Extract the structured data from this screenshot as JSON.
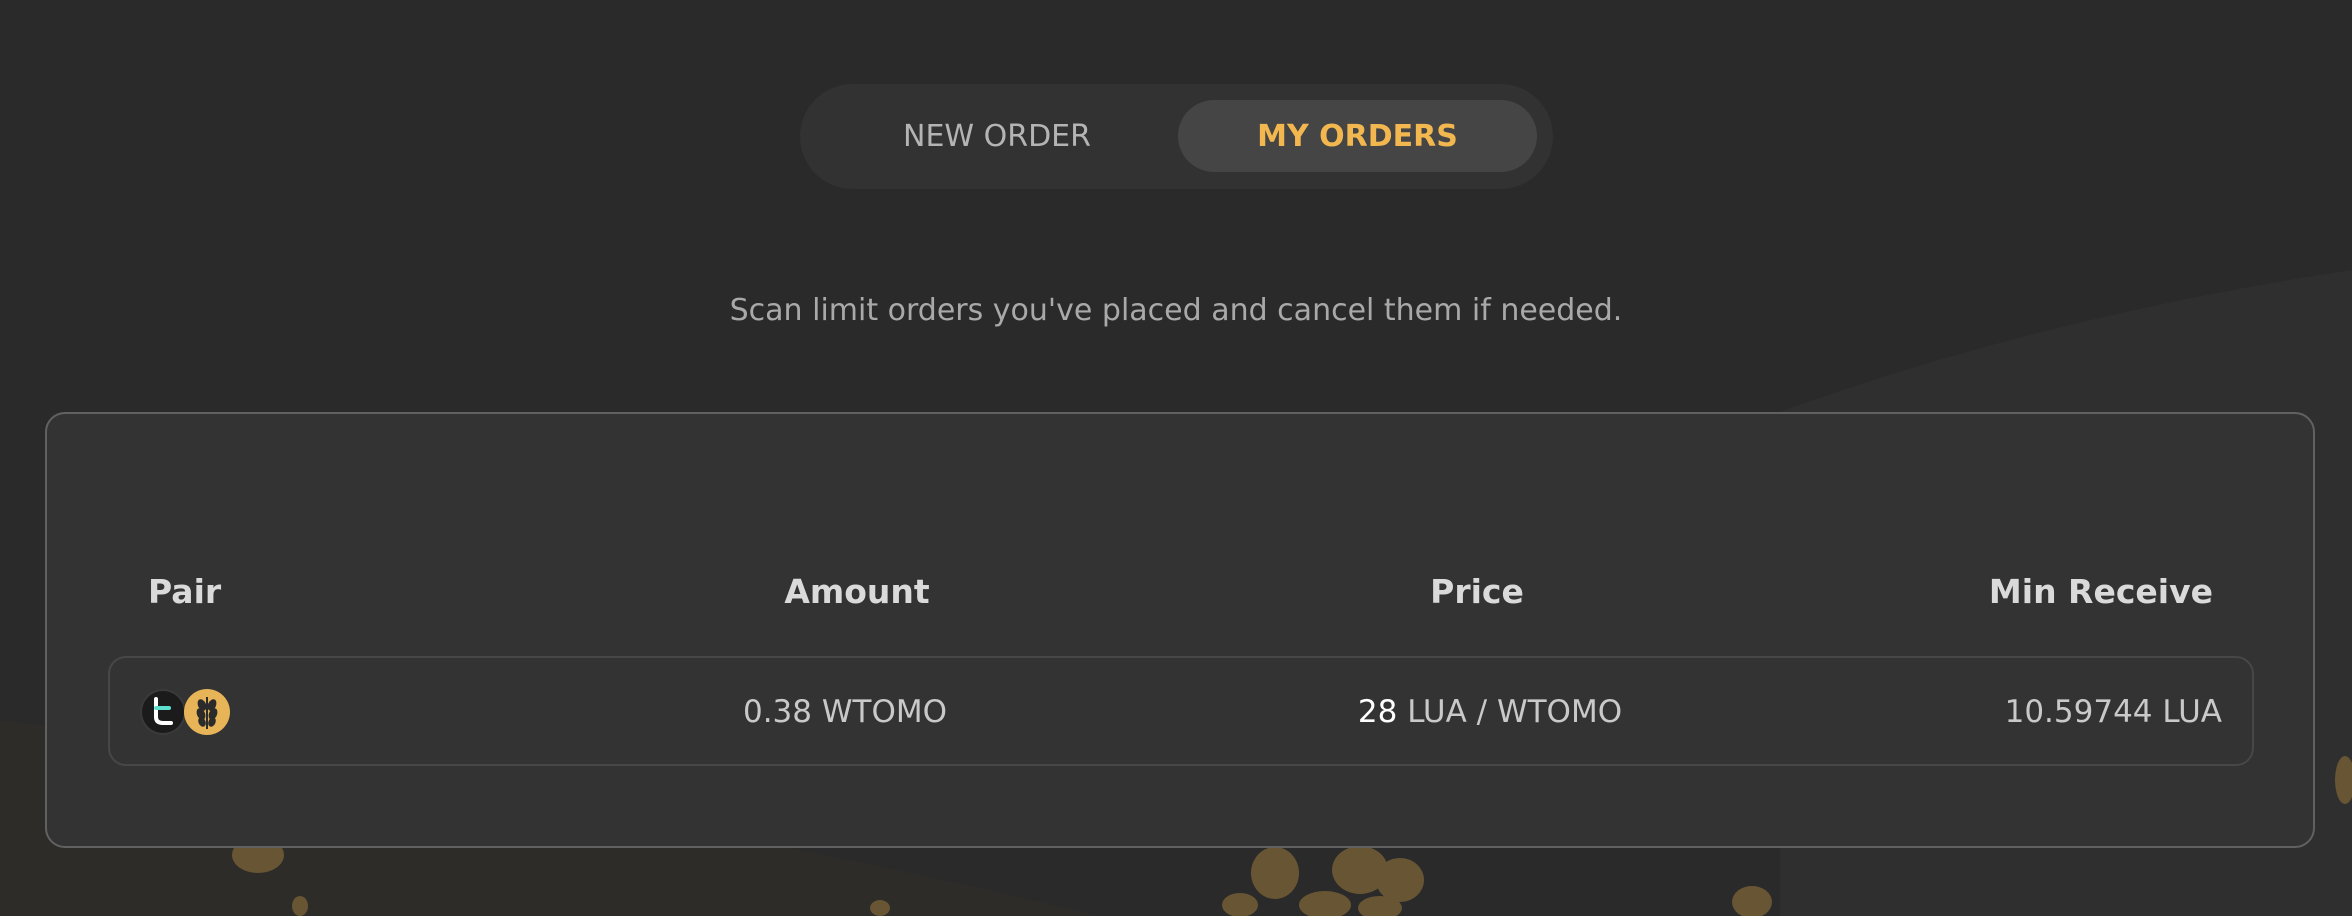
{
  "tabs": {
    "new_order": "NEW ORDER",
    "my_orders": "MY ORDERS",
    "active": "my_orders"
  },
  "subtitle": "Scan limit orders you've placed and cancel them if needed.",
  "table": {
    "headers": {
      "pair": "Pair",
      "amount": "Amount",
      "price": "Price",
      "min_receive": "Min Receive"
    },
    "rows": [
      {
        "pair_icons": [
          "tomo-token-icon",
          "lua-token-icon"
        ],
        "amount": "0.38 WTOMO",
        "price_value": "28",
        "price_unit": "LUA / WTOMO",
        "min_receive": "10.59744 LUA"
      }
    ]
  },
  "colors": {
    "background": "#2a2a2a",
    "card": "#333333",
    "accent": "#f3b74f",
    "muted_text": "#a9a9a9"
  }
}
